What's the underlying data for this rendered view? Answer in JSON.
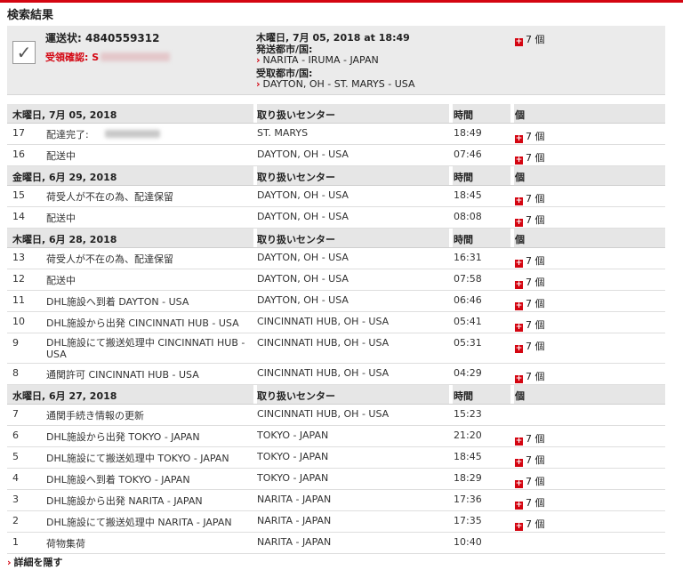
{
  "page": {
    "title": "検索結果",
    "accent": "#d40511"
  },
  "summary": {
    "waybill": "運送状: 4840559312",
    "signed_label": "受領確認:",
    "signed_prefix": "S",
    "date": "木曜日, 7月 05, 2018 at 18:49",
    "origin_label": "発送都市/国:",
    "origin": "NARITA - IRUMA - JAPAN",
    "dest_label": "受取都市/国:",
    "dest": "DAYTON, OH - ST. MARYS - USA",
    "pieces": "7 個"
  },
  "headers": {
    "center": "取り扱いセンター",
    "time": "時間",
    "pieces": "個"
  },
  "groups": [
    {
      "date": "木曜日, 7月 05, 2018",
      "rows": [
        {
          "no": "17",
          "desc": "配達完了: ",
          "redacted": true,
          "loc": "ST. MARYS",
          "time": "18:49",
          "pieces": "7 個"
        },
        {
          "no": "16",
          "desc": "配送中",
          "loc": "DAYTON, OH - USA",
          "time": "07:46",
          "pieces": "7 個"
        }
      ]
    },
    {
      "date": "金曜日, 6月 29, 2018",
      "rows": [
        {
          "no": "15",
          "desc": "荷受人が不在の為、配達保留",
          "loc": "DAYTON, OH - USA",
          "time": "18:45",
          "pieces": "7 個"
        },
        {
          "no": "14",
          "desc": "配送中",
          "loc": "DAYTON, OH - USA",
          "time": "08:08",
          "pieces": "7 個"
        }
      ]
    },
    {
      "date": "木曜日, 6月 28, 2018",
      "rows": [
        {
          "no": "13",
          "desc": "荷受人が不在の為、配達保留",
          "loc": "DAYTON, OH - USA",
          "time": "16:31",
          "pieces": "7 個"
        },
        {
          "no": "12",
          "desc": "配送中",
          "loc": "DAYTON, OH - USA",
          "time": "07:58",
          "pieces": "7 個"
        },
        {
          "no": "11",
          "desc": "DHL施設へ到着 DAYTON - USA",
          "loc": "DAYTON, OH - USA",
          "time": "06:46",
          "pieces": "7 個"
        },
        {
          "no": "10",
          "desc": "DHL施設から出発 CINCINNATI HUB - USA",
          "loc": "CINCINNATI HUB, OH - USA",
          "time": "05:41",
          "pieces": "7 個"
        },
        {
          "no": "9",
          "desc": "DHL施設にて搬送処理中 CINCINNATI HUB - USA",
          "loc": "CINCINNATI HUB, OH - USA",
          "time": "05:31",
          "pieces": "7 個",
          "tall": true
        },
        {
          "no": "8",
          "desc": "通関許可 CINCINNATI HUB - USA",
          "loc": "CINCINNATI HUB, OH - USA",
          "time": "04:29",
          "pieces": "7 個"
        }
      ]
    },
    {
      "date": "水曜日, 6月 27, 2018",
      "rows": [
        {
          "no": "7",
          "desc": "通関手続き情報の更新",
          "loc": "CINCINNATI HUB, OH - USA",
          "time": "15:23",
          "pieces": ""
        },
        {
          "no": "6",
          "desc": "DHL施設から出発 TOKYO - JAPAN",
          "loc": "TOKYO - JAPAN",
          "time": "21:20",
          "pieces": "7 個"
        },
        {
          "no": "5",
          "desc": "DHL施設にて搬送処理中 TOKYO - JAPAN",
          "loc": "TOKYO - JAPAN",
          "time": "18:45",
          "pieces": "7 個"
        },
        {
          "no": "4",
          "desc": "DHL施設へ到着 TOKYO - JAPAN",
          "loc": "TOKYO - JAPAN",
          "time": "18:29",
          "pieces": "7 個"
        },
        {
          "no": "3",
          "desc": "DHL施設から出発 NARITA - JAPAN",
          "loc": "NARITA - JAPAN",
          "time": "17:36",
          "pieces": "7 個"
        },
        {
          "no": "2",
          "desc": "DHL施設にて搬送処理中 NARITA - JAPAN",
          "loc": "NARITA - JAPAN",
          "time": "17:35",
          "pieces": "7 個"
        },
        {
          "no": "1",
          "desc": "荷物集荷",
          "loc": "NARITA - JAPAN",
          "time": "10:40",
          "pieces": ""
        }
      ]
    }
  ],
  "footer": {
    "hide_details": "詳細を隠す"
  }
}
